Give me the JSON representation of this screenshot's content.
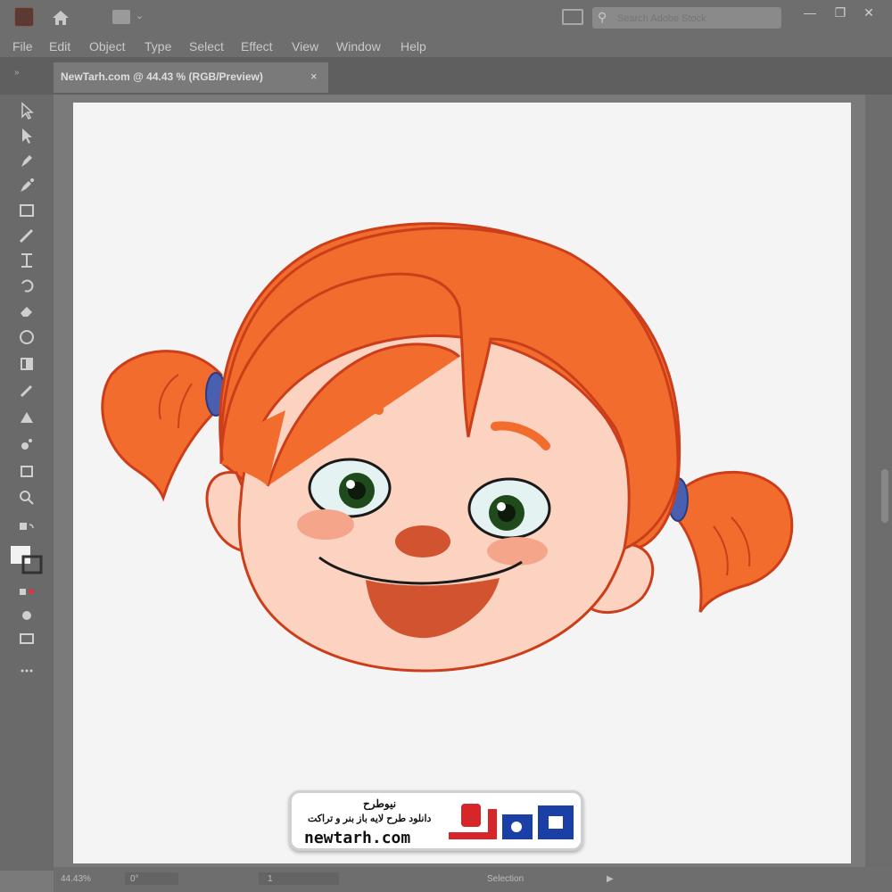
{
  "app": {
    "icon": "illustrator-app-icon"
  },
  "titlebar": {
    "search_placeholder": "Search Adobe Stock",
    "window_buttons": [
      "—",
      "❐",
      "✕"
    ]
  },
  "menu": [
    "File",
    "Edit",
    "Object",
    "Type",
    "Select",
    "Effect",
    "View",
    "Window",
    "Help"
  ],
  "document_tab": {
    "label": "NewTarh.com @ 44.43 % (RGB/Preview)",
    "close": "×"
  },
  "status": {
    "zoom": "44.43%",
    "rotation": "0°",
    "artboard": "1",
    "tool": "Selection"
  },
  "badge": {
    "title": "نیوطرح",
    "subtitle": "دانلود طرح لایه باز بنر و تراکت",
    "url": "newtarh.com",
    "logo_colors": [
      "#1a3fa6",
      "#d6262a"
    ]
  },
  "colors": {
    "hair": "#f26c2e",
    "skin": "#fcd2c0",
    "outline": "#cc3e1a",
    "hair_tie": "#4a5fb0",
    "tongue": "#d2532f",
    "cheek": "#f5a58a",
    "eye_white": "#e4f2f2",
    "iris": "#1f4a1c"
  }
}
